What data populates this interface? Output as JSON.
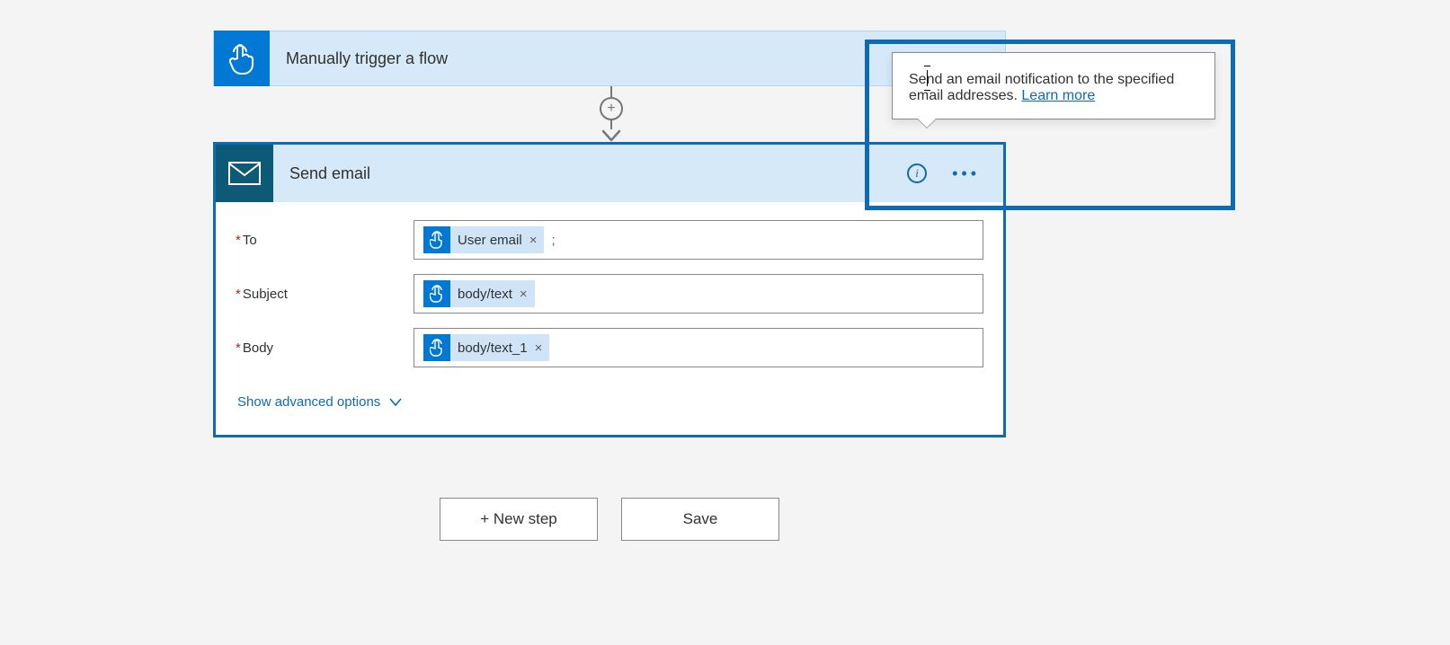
{
  "trigger": {
    "title": "Manually trigger a flow"
  },
  "action": {
    "title": "Send email",
    "tooltip_text": "Send an email notification to the specified email addresses. ",
    "tooltip_link": "Learn more",
    "fields": {
      "to": {
        "label": "To",
        "token": "User email",
        "trailing": ";"
      },
      "subject": {
        "label": "Subject",
        "token": "body/text"
      },
      "body": {
        "label": "Body",
        "token": "body/text_1"
      }
    },
    "advanced": "Show advanced options"
  },
  "buttons": {
    "new_step": "+ New step",
    "save": "Save"
  }
}
